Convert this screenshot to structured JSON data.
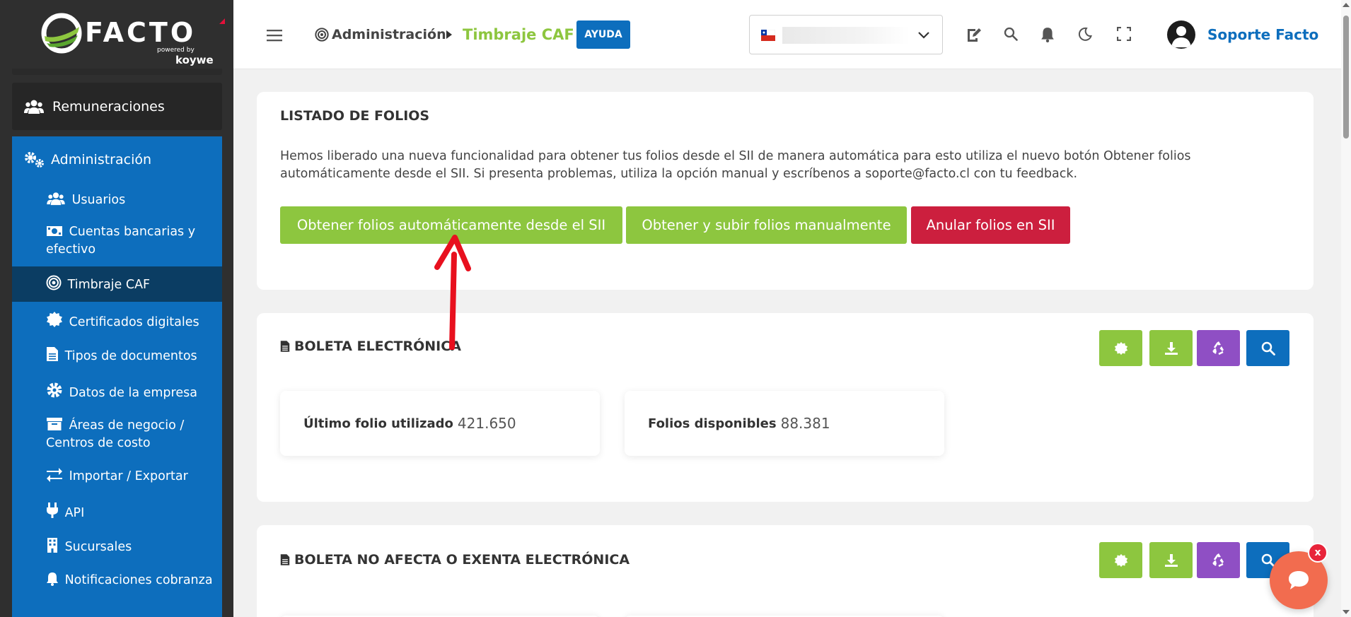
{
  "brand": {
    "name": "FACTO",
    "powered_by": "powered by",
    "partner": "koywe"
  },
  "sidebar": {
    "remuneraciones": "Remuneraciones",
    "administracion": "Administración",
    "items": [
      {
        "label": "Usuarios",
        "icon": "users-icon"
      },
      {
        "label": "Cuentas bancarias y efectivo",
        "icon": "money-icon"
      },
      {
        "label": "Timbraje CAF",
        "icon": "target-icon",
        "active": true
      },
      {
        "label": "Certificados digitales",
        "icon": "certificate-icon"
      },
      {
        "label": "Tipos de documentos",
        "icon": "document-icon"
      },
      {
        "label": "Datos de la empresa",
        "icon": "gear-icon"
      },
      {
        "label": "Áreas de negocio / Centros de costo",
        "icon": "archive-icon"
      },
      {
        "label": "Importar / Exportar",
        "icon": "exchange-icon"
      },
      {
        "label": "API",
        "icon": "plug-icon"
      },
      {
        "label": "Sucursales",
        "icon": "building-icon"
      },
      {
        "label": "Notificaciones cobranza",
        "icon": "bell-icon"
      }
    ]
  },
  "header": {
    "breadcrumb_parent": "Administración",
    "breadcrumb_current": "Timbraje CAF",
    "help_label": "AYUDA",
    "user_name": "Soporte Facto"
  },
  "folios": {
    "title": "LISTADO DE FOLIOS",
    "info": "Hemos liberado una nueva funcionalidad para obtener tus folios desde el SII de manera automática para esto utiliza el nuevo botón Obtener folios automáticamente desde el SII. Si presenta problemas, utiliza la opción manual y escríbenos a soporte@facto.cl con tu feedback.",
    "btn_auto": "Obtener folios automáticamente desde el SII",
    "btn_manual": "Obtener y subir folios manualmente",
    "btn_anular": "Anular folios en SII"
  },
  "boleta": {
    "title": "BOLETA ELECTRÓNICA",
    "last_label": "Último folio utilizado",
    "last_value": "421.650",
    "available_label": "Folios disponibles",
    "available_value": "88.381"
  },
  "noafecta": {
    "title": "BOLETA NO AFECTA O EXENTA ELECTRÓNICA"
  },
  "chat": {
    "close": "x"
  },
  "colors": {
    "green": "#8dc63f",
    "blue": "#0d6ebd",
    "red": "#cc1f3e",
    "purple": "#8f4fc4",
    "sidebar_active": "#0b3d63",
    "arrow": "#e8101e"
  }
}
